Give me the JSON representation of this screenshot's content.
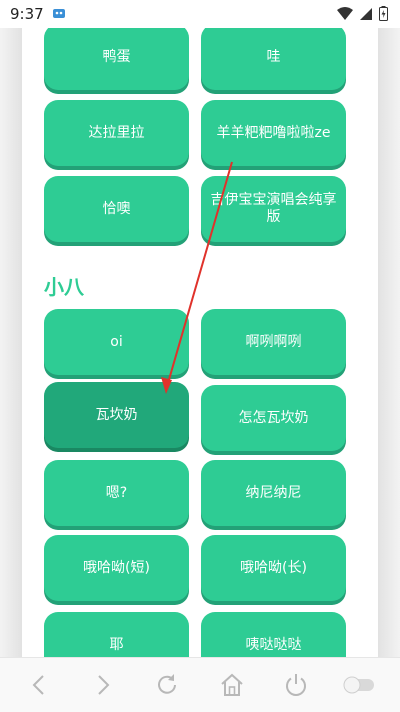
{
  "status_bar": {
    "time": "9:37",
    "icons": [
      "app-notification-icon",
      "wifi-icon",
      "signal-icon",
      "battery-icon"
    ]
  },
  "section": {
    "title": "小八"
  },
  "buttons_above": [
    {
      "label": "鸭蛋"
    },
    {
      "label": "哇"
    },
    {
      "label": "达拉里拉"
    },
    {
      "label": "羊羊粑粑噜啦啦ze"
    },
    {
      "label": "恰噢"
    },
    {
      "label": "吉伊宝宝演唱会纯享版"
    }
  ],
  "buttons_section": [
    {
      "label": "oi"
    },
    {
      "label": "啊咧啊咧"
    },
    {
      "label": "瓦坎奶"
    },
    {
      "label": "怎怎瓦坎奶"
    },
    {
      "label": "嗯?"
    },
    {
      "label": "纳尼纳尼"
    },
    {
      "label": "哦哈呦(短)"
    },
    {
      "label": "哦哈呦(长)"
    },
    {
      "label": "耶"
    },
    {
      "label": "咦哒哒哒"
    }
  ],
  "nav_bar": {
    "items": [
      "back-icon",
      "forward-icon",
      "refresh-icon",
      "home-icon",
      "power-icon",
      "toggle-icon"
    ]
  },
  "colors": {
    "accent": "#2ecc94",
    "pressed": "#21a87a",
    "annotation_arrow": "#e0322b"
  }
}
